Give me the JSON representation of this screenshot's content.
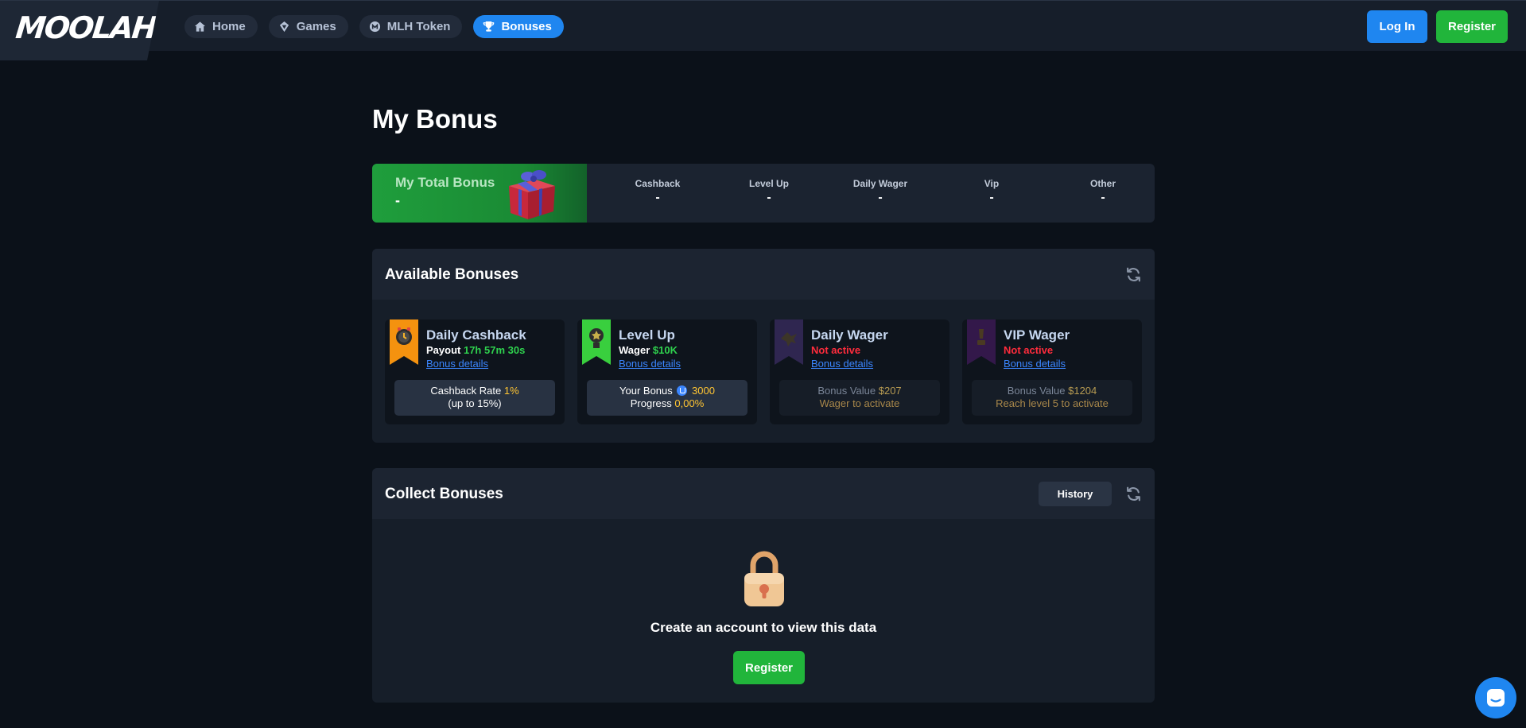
{
  "header": {
    "logo": "MOOLAH",
    "nav": [
      {
        "label": "Home",
        "icon": "home-icon"
      },
      {
        "label": "Games",
        "icon": "games-icon"
      },
      {
        "label": "MLH Token",
        "icon": "token-icon"
      },
      {
        "label": "Bonuses",
        "icon": "trophy-icon",
        "active": true
      }
    ],
    "login_label": "Log In",
    "register_label": "Register"
  },
  "page": {
    "title": "My Bonus",
    "summary": {
      "total_label": "My Total Bonus",
      "total_value": "-",
      "stats": [
        {
          "label": "Cashback",
          "value": "-"
        },
        {
          "label": "Level Up",
          "value": "-"
        },
        {
          "label": "Daily Wager",
          "value": "-"
        },
        {
          "label": "Vip",
          "value": "-"
        },
        {
          "label": "Other",
          "value": "-"
        }
      ]
    },
    "available": {
      "title": "Available Bonuses",
      "cards": [
        {
          "title": "Daily Cashback",
          "line_prefix": "Payout",
          "line_value": "17h 57m 30s",
          "link": "Bonus details",
          "box_line1_prefix": "Cashback Rate",
          "box_line1_value": "1%",
          "box_line2": "(up to 15%)"
        },
        {
          "title": "Level Up",
          "line_prefix": "Wager",
          "line_value": "$10K",
          "link": "Bonus details",
          "box_line1_prefix": "Your Bonus",
          "box_line1_value": "3000",
          "box_line2_prefix": "Progress",
          "box_line2_value": "0,00%"
        },
        {
          "title": "Daily Wager",
          "status": "Not active",
          "link": "Bonus details",
          "box_line1_prefix": "Bonus Value",
          "box_line1_value": "$207",
          "box_line2": "Wager to activate"
        },
        {
          "title": "VIP Wager",
          "status": "Not active",
          "link": "Bonus details",
          "box_line1_prefix": "Bonus Value",
          "box_line1_value": "$1204",
          "box_line2": "Reach level 5 to activate"
        }
      ]
    },
    "collect": {
      "title": "Collect Bonuses",
      "history_label": "History",
      "message": "Create an account to view this data",
      "register_label": "Register"
    }
  },
  "colors": {
    "background": "#0b1119",
    "accent_blue": "#1f86f0",
    "accent_green": "#21b53b",
    "status_red": "#ff2c3c",
    "highlight_yellow": "#ffc533"
  }
}
